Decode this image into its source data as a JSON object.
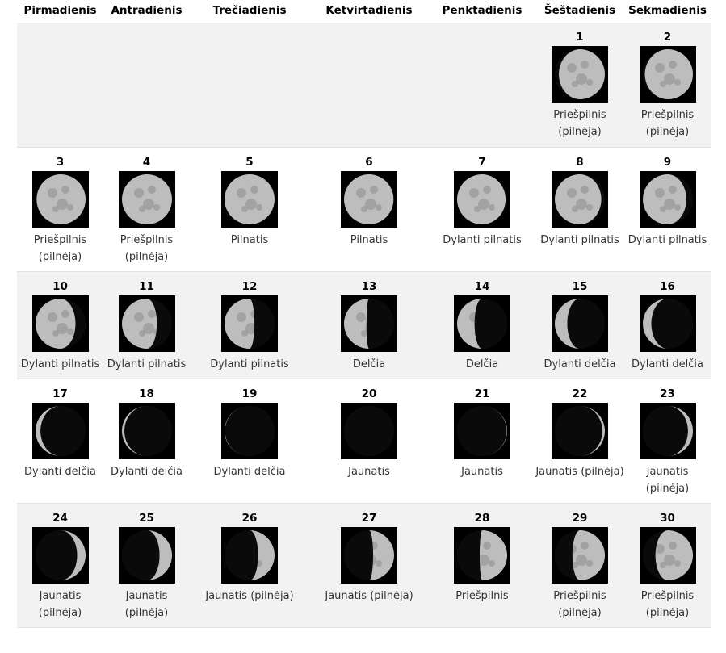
{
  "weekdays": [
    "Pirmadienis",
    "Antradienis",
    "Trečiadienis",
    "Ketvirtadienis",
    "Penktadienis",
    "Šeštadienis",
    "Sekmadienis"
  ],
  "weeks": [
    {
      "rowHeight": 154,
      "days": [
        null,
        null,
        null,
        null,
        null,
        {
          "day": "1",
          "label": "Priešpilnis (pilnėja)",
          "illum": 0.92,
          "waxing": true
        },
        {
          "day": "2",
          "label": "Priešpilnis (pilnėja)",
          "illum": 0.96,
          "waxing": true
        }
      ]
    },
    {
      "rowHeight": 153,
      "days": [
        {
          "day": "3",
          "label": "Priešpilnis (pilnėja)",
          "illum": 0.98,
          "waxing": true
        },
        {
          "day": "4",
          "label": "Priešpilnis (pilnėja)",
          "illum": 1.0,
          "waxing": true
        },
        {
          "day": "5",
          "label": "Pilnatis",
          "illum": 1.0,
          "waxing": true
        },
        {
          "day": "6",
          "label": "Pilnatis",
          "illum": 0.99,
          "waxing": false
        },
        {
          "day": "7",
          "label": "Dylanti pilnatis",
          "illum": 0.97,
          "waxing": false
        },
        {
          "day": "8",
          "label": "Dylanti pilnatis",
          "illum": 0.93,
          "waxing": false
        },
        {
          "day": "9",
          "label": "Dylanti pilnatis",
          "illum": 0.87,
          "waxing": false
        }
      ]
    },
    {
      "rowHeight": 132,
      "days": [
        {
          "day": "10",
          "label": "Dylanti pilnatis",
          "illum": 0.8,
          "waxing": false
        },
        {
          "day": "11",
          "label": "Dylanti pilnatis",
          "illum": 0.7,
          "waxing": false
        },
        {
          "day": "12",
          "label": "Dylanti pilnatis",
          "illum": 0.6,
          "waxing": false
        },
        {
          "day": "13",
          "label": "Delčia",
          "illum": 0.45,
          "waxing": false
        },
        {
          "day": "14",
          "label": "Delčia",
          "illum": 0.35,
          "waxing": false
        },
        {
          "day": "15",
          "label": "Dylanti delčia",
          "illum": 0.25,
          "waxing": false
        },
        {
          "day": "16",
          "label": "Dylanti delčia",
          "illum": 0.17,
          "waxing": false
        }
      ]
    },
    {
      "rowHeight": 153,
      "days": [
        {
          "day": "17",
          "label": "Dylanti delčia",
          "illum": 0.1,
          "waxing": false
        },
        {
          "day": "18",
          "label": "Dylanti delčia",
          "illum": 0.05,
          "waxing": false
        },
        {
          "day": "19",
          "label": "Dylanti delčia",
          "illum": 0.01,
          "waxing": false
        },
        {
          "day": "20",
          "label": "Jaunatis",
          "illum": 0.0,
          "waxing": true
        },
        {
          "day": "21",
          "label": "Jaunatis",
          "illum": 0.01,
          "waxing": true
        },
        {
          "day": "22",
          "label": "Jaunatis (pilnėja)",
          "illum": 0.05,
          "waxing": true
        },
        {
          "day": "23",
          "label": "Jaunatis (pilnėja)",
          "illum": 0.1,
          "waxing": true
        }
      ]
    },
    {
      "rowHeight": 153,
      "days": [
        {
          "day": "24",
          "label": "Jaunatis (pilnėja)",
          "illum": 0.17,
          "waxing": true
        },
        {
          "day": "25",
          "label": "Jaunatis (pilnėja)",
          "illum": 0.25,
          "waxing": true
        },
        {
          "day": "26",
          "label": "Jaunatis (pilnėja)",
          "illum": 0.33,
          "waxing": true
        },
        {
          "day": "27",
          "label": "Jaunatis (pilnėja)",
          "illum": 0.42,
          "waxing": true
        },
        {
          "day": "28",
          "label": "Priešpilnis",
          "illum": 0.55,
          "waxing": true
        },
        {
          "day": "29",
          "label": "Priešpilnis (pilnėja)",
          "illum": 0.65,
          "waxing": true
        },
        {
          "day": "30",
          "label": "Priešpilnis (pilnėja)",
          "illum": 0.75,
          "waxing": true
        }
      ]
    }
  ]
}
